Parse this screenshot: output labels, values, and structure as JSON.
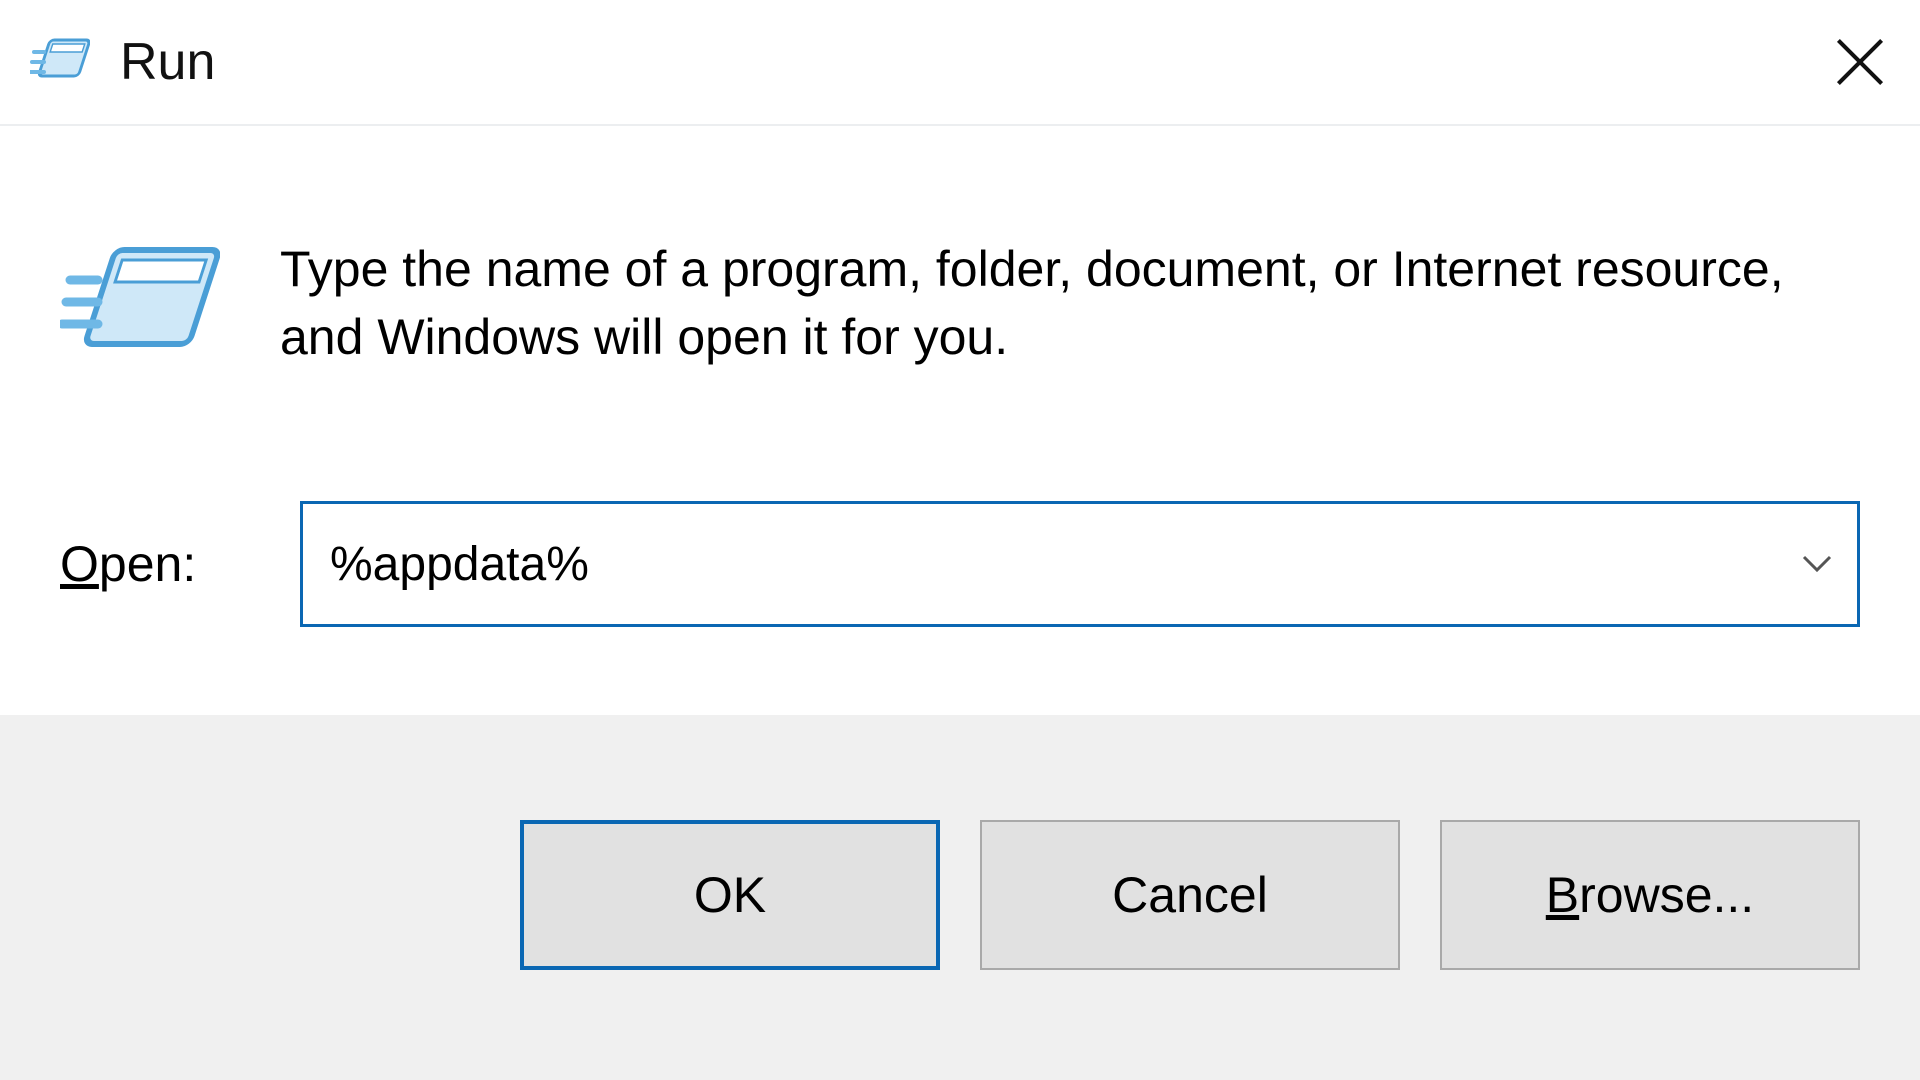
{
  "title": "Run",
  "description": "Type the name of a program, folder, document, or Internet resource, and Windows will open it for you.",
  "open": {
    "label_prefix": "O",
    "label_rest": "pen:",
    "value": "%appdata%"
  },
  "buttons": {
    "ok": "OK",
    "cancel": "Cancel",
    "browse_prefix": "B",
    "browse_rest": "rowse..."
  },
  "icons": {
    "title": "run-icon",
    "main": "run-icon",
    "close": "close-icon",
    "chevron": "chevron-down-icon"
  }
}
